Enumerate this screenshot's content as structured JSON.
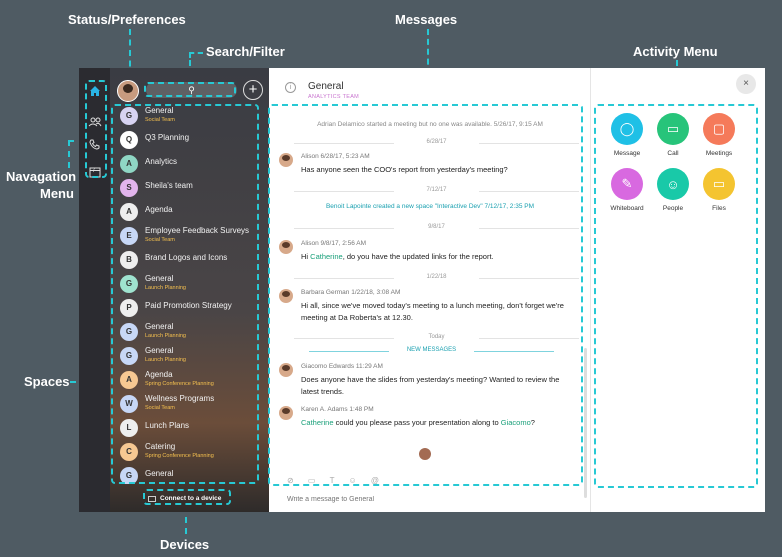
{
  "callouts": {
    "status": "Status/Preferences",
    "search": "Search/Filter",
    "messages": "Messages",
    "activity": "Activity Menu",
    "nav_line1": "Navagation",
    "nav_line2": "Menu",
    "spaces": "Spaces",
    "devices": "Devices"
  },
  "nav": {
    "calendar_day": "7"
  },
  "sidebar": {
    "search_glyph": "⚲",
    "plus": "+",
    "spaces": [
      {
        "letter": "G",
        "name": "General",
        "sub": "Social Team",
        "color": "#d7d3f2"
      },
      {
        "letter": "Q",
        "name": "Q3 Planning",
        "sub": "",
        "color": "#ffffff"
      },
      {
        "letter": "A",
        "name": "Analytics",
        "sub": "",
        "color": "#8fd6c4"
      },
      {
        "letter": "S",
        "name": "Sheila's team",
        "sub": "",
        "color": "#e2b4ec"
      },
      {
        "letter": "A",
        "name": "Agenda",
        "sub": "",
        "color": "#eeeeee"
      },
      {
        "letter": "E",
        "name": "Employee Feedback Surveys",
        "sub": "Social Team",
        "color": "#c7d7f6"
      },
      {
        "letter": "B",
        "name": "Brand Logos and Icons",
        "sub": "",
        "color": "#eeeeee"
      },
      {
        "letter": "G",
        "name": "General",
        "sub": "Launch Planning",
        "color": "#9fe3cf"
      },
      {
        "letter": "P",
        "name": "Paid Promotion Strategy",
        "sub": "",
        "color": "#eeeeee"
      },
      {
        "letter": "G",
        "name": "General",
        "sub": "Launch Planning",
        "color": "#c7d7f6"
      },
      {
        "letter": "G",
        "name": "General",
        "sub": "Launch Planning",
        "color": "#c7d7f6"
      },
      {
        "letter": "A",
        "name": "Agenda",
        "sub": "Spring Conference Planning",
        "color": "#f7c892"
      },
      {
        "letter": "W",
        "name": "Wellness Programs",
        "sub": "Social Team",
        "color": "#c7d7f6"
      },
      {
        "letter": "L",
        "name": "Lunch Plans",
        "sub": "",
        "color": "#eeeeee"
      },
      {
        "letter": "C",
        "name": "Catering",
        "sub": "Spring Conference Planning",
        "color": "#f7c892"
      },
      {
        "letter": "G",
        "name": "General",
        "sub": "",
        "color": "#c7d7f6"
      }
    ],
    "device": "Connect to a device"
  },
  "conversation": {
    "title": "General",
    "subtitle": "ANALYTICS TEAM",
    "system1": "Adrian Delamico started a meeting but no one was available. 5/26/17, 9:15 AM",
    "date1": "6/28/17",
    "m1_meta": "Alison  6/28/17, 5:23 AM",
    "m1_text": "Has anyone seen the COO's report from yesterday's meeting?",
    "date2": "7/12/17",
    "system2": "Benoit Lapointe created a new space \"Interactive Dev\" 7/12/17, 2:35 PM",
    "date3": "9/8/17",
    "m2_meta": "Alison  9/8/17, 2:56 AM",
    "m2_pre": "Hi ",
    "m2_mention": "Catherine",
    "m2_post": ", do you have the updated links for the report.",
    "date4": "1/22/18",
    "m3_meta": "Barbara German  1/22/18, 3:08 AM",
    "m3_text": "Hi all, since we've moved today's meeting to a lunch meeting, don't forget we're meeting at Da Roberta's at 12.30.",
    "date5": "Today",
    "new_messages": "NEW MESSAGES",
    "m4_meta": "Giacomo Edwards  11:29 AM",
    "m4_text": "Does anyone have the slides from yesterday's meeting? Wanted to review the latest trends.",
    "m5_meta": "Karen A. Adams  1:48 PM",
    "m5_mention": "Catherine",
    "m5_mid": " could you please pass your presentation along to ",
    "m5_mention2": "Giacomo",
    "m5_end": "?",
    "tools": "⊘ ▭ T ☺ @",
    "composer_placeholder": "Write a message to General"
  },
  "activity": {
    "close": "×",
    "items": [
      {
        "label": "Message",
        "color": "#1fc0e6",
        "icon": "message-icon",
        "glyph": "◯"
      },
      {
        "label": "Call",
        "color": "#27c47a",
        "icon": "video-icon",
        "glyph": "▭"
      },
      {
        "label": "Meetings",
        "color": "#f57a5a",
        "icon": "calendar-icon",
        "glyph": "▢"
      },
      {
        "label": "Whiteboard",
        "color": "#d869e0",
        "icon": "pencil-icon",
        "glyph": "✎"
      },
      {
        "label": "People",
        "color": "#19c9a8",
        "icon": "person-icon",
        "glyph": "☺"
      },
      {
        "label": "Files",
        "color": "#f4c430",
        "icon": "folder-icon",
        "glyph": "▭"
      }
    ]
  }
}
